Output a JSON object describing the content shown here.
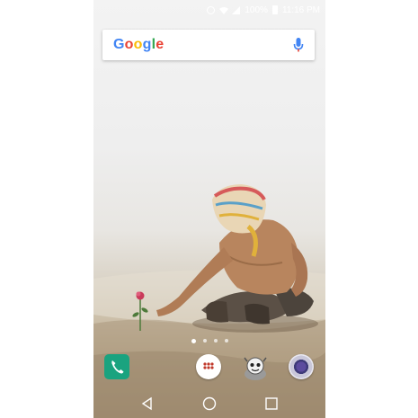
{
  "status_bar": {
    "battery_text": "100%",
    "time": "11:16 PM",
    "icons": [
      "nfc-icon",
      "wifi-icon",
      "signal-icon",
      "battery-icon"
    ]
  },
  "search": {
    "logo_letters": [
      {
        "char": "G",
        "color": "#4285F4"
      },
      {
        "char": "o",
        "color": "#EA4335"
      },
      {
        "char": "o",
        "color": "#FBBC05"
      },
      {
        "char": "g",
        "color": "#4285F4"
      },
      {
        "char": "l",
        "color": "#34A853"
      },
      {
        "char": "e",
        "color": "#EA4335"
      }
    ],
    "mic_icon": "mic-icon"
  },
  "home": {
    "page_count": 4,
    "active_page": 1
  },
  "dock": {
    "apps": [
      {
        "name": "Phone",
        "icon": "phone-icon",
        "color": "#1aa37f"
      },
      {
        "name": "Apps",
        "icon": "apps-grid-icon",
        "color": "#ffffff"
      },
      {
        "name": "Sticker App",
        "icon": "cartoon-character-icon"
      },
      {
        "name": "Camera",
        "icon": "camera-icon",
        "color": "#5c4b9e"
      }
    ]
  },
  "nav": {
    "buttons": [
      "back-icon",
      "home-icon",
      "recents-icon"
    ]
  }
}
